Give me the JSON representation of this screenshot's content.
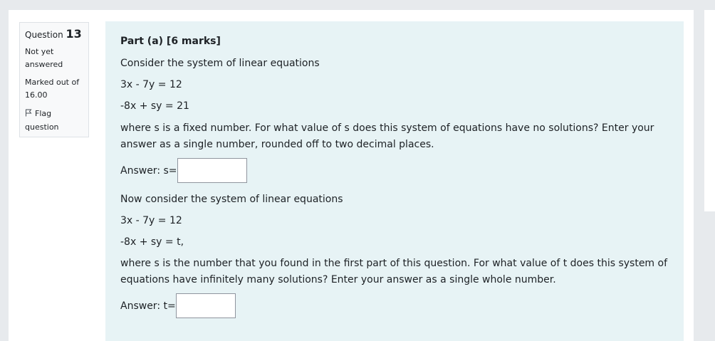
{
  "info": {
    "question_label": "Question",
    "question_number": "13",
    "status_line1": "Not yet",
    "status_line2": "answered",
    "marks_line1": "Marked out of",
    "marks_line2": "16.00",
    "flag_line1": "Flag",
    "flag_line2": "question",
    "flag_icon": "flag-icon"
  },
  "content": {
    "part_title": "Part (a) [6 marks]",
    "intro1": "Consider the system of linear equations",
    "eq1": "3x - 7y = 12",
    "eq2": "-8x + sy = 21",
    "q1_line1": "where s is a fixed number. For what value of s does this system of equations have no solutions? Enter your",
    "q1_line2": "answer as a single number, rounded off to two decimal places.",
    "answer1_label": "Answer: s=",
    "answer1_value": "",
    "intro2": "Now consider the system of linear equations",
    "eq3": "3x - 7y = 12",
    "eq4": "-8x + sy = t,",
    "q2_line1": "where s is the number that you found in the first part of this question. For what value of t does this system of",
    "q2_line2": "equations have infinitely many solutions? Enter your answer as a single whole number.",
    "answer2_label": "Answer: t=",
    "answer2_value": ""
  }
}
